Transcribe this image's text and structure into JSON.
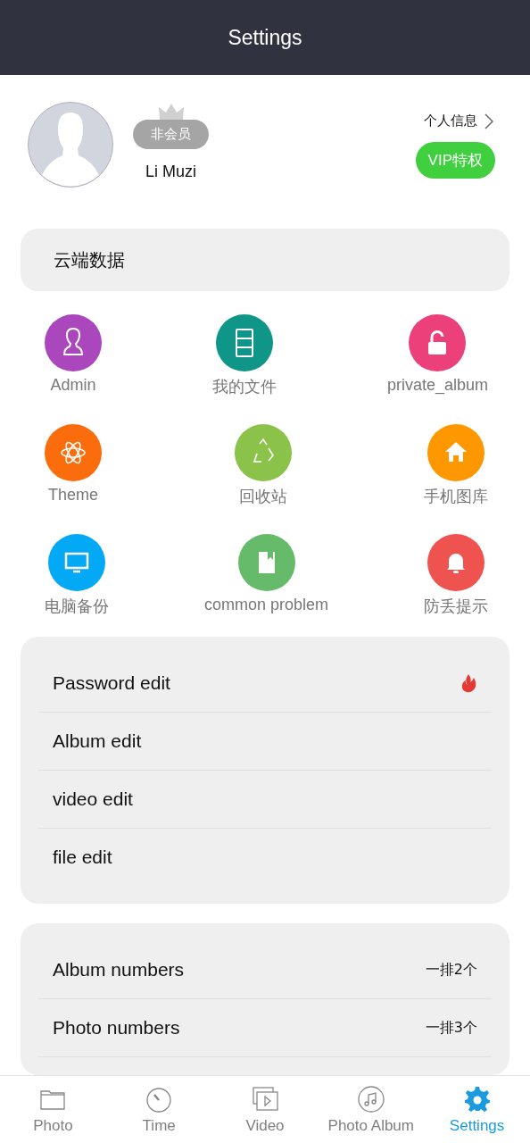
{
  "header": {
    "title": "Settings"
  },
  "profile": {
    "badge": "非会员",
    "name": "Li Muzi",
    "info_link": "个人信息",
    "vip_button": "VIP特权"
  },
  "cloud": {
    "label": "云端数据"
  },
  "shortcuts": [
    {
      "label": "Admin",
      "color": "#ab47bc"
    },
    {
      "label": "我的文件",
      "color": "#0f9688"
    },
    {
      "label": "private_album",
      "color": "#ec407a"
    },
    {
      "label": "Theme",
      "color": "#fb6d0c"
    },
    {
      "label": "回收站",
      "color": "#8bc34a"
    },
    {
      "label": "手机图库",
      "color": "#ff9800"
    },
    {
      "label": "电脑备份",
      "color": "#03a9f4"
    },
    {
      "label": "common problem",
      "color": "#66bb6a"
    },
    {
      "label": "防丢提示",
      "color": "#ef5350"
    }
  ],
  "edit_menu": [
    {
      "label": "Password edit",
      "hot": true
    },
    {
      "label": "Album edit",
      "hot": false
    },
    {
      "label": "video edit",
      "hot": false
    },
    {
      "label": "file edit",
      "hot": false
    }
  ],
  "layout_menu": [
    {
      "label": "Album numbers",
      "value": "一排2个"
    },
    {
      "label": "Photo numbers",
      "value": "一排3个"
    }
  ],
  "tabs": [
    {
      "label": "Photo",
      "selected": false
    },
    {
      "label": "Time",
      "selected": false
    },
    {
      "label": "Video",
      "selected": false
    },
    {
      "label": "Photo Album",
      "selected": false
    },
    {
      "label": "Settings",
      "selected": true
    }
  ]
}
